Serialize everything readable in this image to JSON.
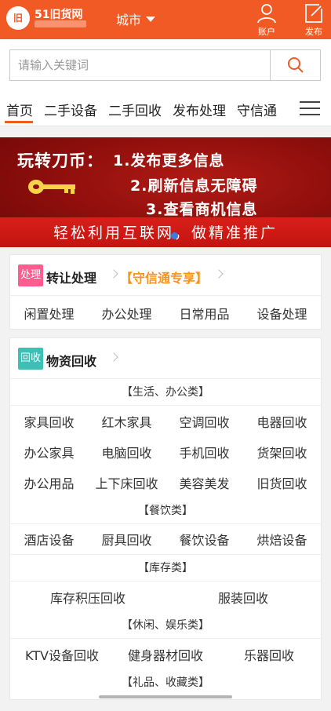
{
  "header": {
    "logo_text": "51旧货网",
    "logo_mark": "旧",
    "city_label": "城市",
    "account_label": "账户",
    "publish_label": "发布",
    "brand_color": "#f15a24"
  },
  "search": {
    "placeholder": "请输入关键词",
    "value": "",
    "icon": "search-icon"
  },
  "nav": {
    "items": [
      {
        "label": "首页",
        "active": true
      },
      {
        "label": "二手设备",
        "active": false
      },
      {
        "label": "二手回收",
        "active": false
      },
      {
        "label": "发布处理",
        "active": false
      },
      {
        "label": "守信通",
        "active": false
      }
    ],
    "menu_icon": "hamburger-icon"
  },
  "banner": {
    "title": "玩转刀币：",
    "line1": "1.发布更多信息",
    "line2": "2.刷新信息无障碍",
    "line3": "3.查看商机信息",
    "footer": "轻松利用互联网，做精准推广"
  },
  "transfer": {
    "badge": "处理",
    "badge_color": "#ff5d8f",
    "title": "转让处理",
    "vip_label": "【守信通专享】",
    "items": [
      "闲置处理",
      "办公处理",
      "日常用品",
      "设备处理"
    ]
  },
  "recycle": {
    "badge": "回收",
    "badge_color": "#3cc0b6",
    "title": "物资回收",
    "life_office_header": "【生活、办公类】",
    "life_office_rows": [
      [
        "家具回收",
        "红木家具",
        "空调回收",
        "电器回收"
      ],
      [
        "办公家具",
        "电脑回收",
        "手机回收",
        "货架回收"
      ],
      [
        "办公用品",
        "上下床回收",
        "美容美发",
        "旧货回收"
      ]
    ],
    "catering_header": "【餐饮类】",
    "catering_items": [
      "酒店设备",
      "厨具回收",
      "餐饮设备",
      "烘焙设备"
    ],
    "stock_header": "【库存类】",
    "stock_items": [
      "库存积压回收",
      "服装回收"
    ],
    "leisure_header": "【休闲、娱乐类】",
    "leisure_items": [
      "KTV设备回收",
      "健身器材回收",
      "乐器回收"
    ],
    "gift_header": "【礼品、收藏类】"
  }
}
